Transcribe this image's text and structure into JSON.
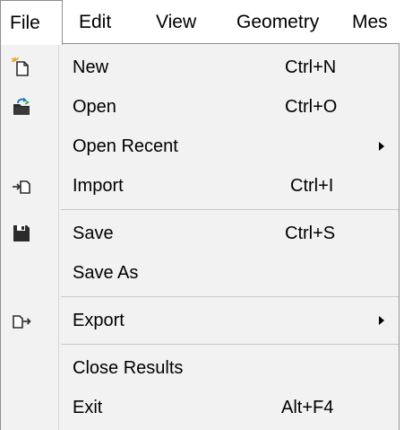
{
  "menubar": {
    "items": [
      {
        "label": "File",
        "active": true
      },
      {
        "label": "Edit",
        "active": false
      },
      {
        "label": "View",
        "active": false
      },
      {
        "label": "Geometry",
        "active": false
      },
      {
        "label": "Mes",
        "active": false
      }
    ]
  },
  "file_menu": {
    "items": [
      {
        "label": "New",
        "shortcut": "Ctrl+N",
        "icon": "new-file-icon"
      },
      {
        "label": "Open",
        "shortcut": "Ctrl+O",
        "icon": "open-folder-icon"
      },
      {
        "label": "Open Recent",
        "submenu": true
      },
      {
        "label": "Import",
        "shortcut": "Ctrl+I",
        "icon": "import-icon"
      },
      {
        "label": "Save",
        "shortcut": "Ctrl+S",
        "icon": "save-icon"
      },
      {
        "label": "Save As"
      },
      {
        "label": "Export",
        "submenu": true,
        "icon": "export-icon"
      },
      {
        "label": "Close Results"
      },
      {
        "label": "Exit",
        "shortcut": "Alt+F4"
      }
    ]
  },
  "colors": {
    "menu_background": "#f2f2f2",
    "menu_border": "#8f8f8f",
    "separator": "#c9c9c9",
    "icon_blue": "#1e78c8",
    "icon_yellow": "#e0a020",
    "icon_dark": "#2b2b2b"
  }
}
